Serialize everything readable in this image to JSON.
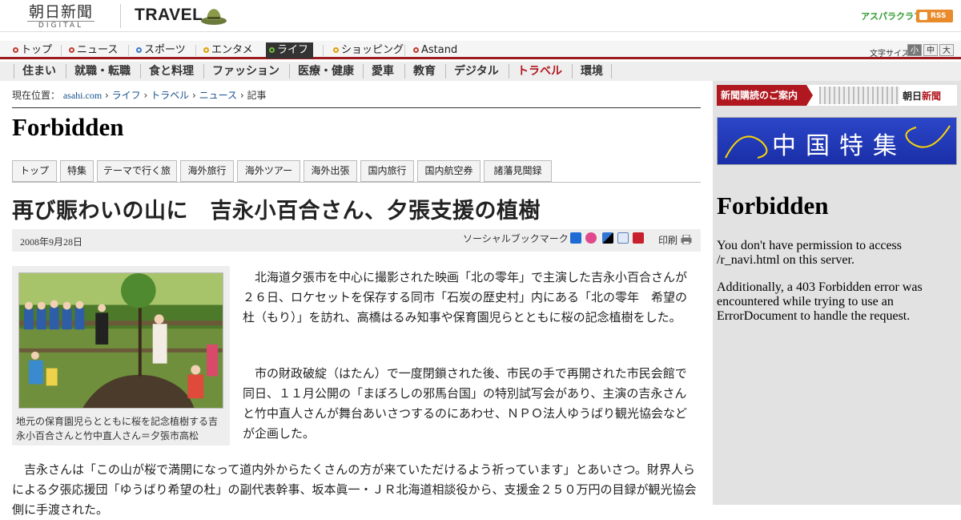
{
  "header": {
    "logo_main": "朝日新聞",
    "logo_sub": "DIGITAL",
    "section_title": "TRAVEL",
    "asupara_link": "アスパラクラブ",
    "rss_label": "RSS"
  },
  "global_nav": {
    "items": [
      {
        "label": "トップ",
        "dot_color": "#c0392b"
      },
      {
        "label": "ニュース",
        "dot_color": "#c0392b"
      },
      {
        "label": "スポーツ",
        "dot_color": "#3a7cc9"
      },
      {
        "label": "エンタメ",
        "dot_color": "#e0a000"
      },
      {
        "label": "ライフ",
        "dot_color": "#6fbf3a",
        "active": true
      },
      {
        "label": "ショッピング",
        "dot_color": "#e0a000"
      },
      {
        "label": "Astand",
        "dot_color": "#c0392b"
      }
    ],
    "font_size_label": "文字サイズ",
    "font_sizes": [
      "小",
      "中",
      "大"
    ]
  },
  "sub_nav": {
    "items": [
      "住まい",
      "就職・転職",
      "食と料理",
      "ファッション",
      "医療・健康",
      "愛車",
      "教育",
      "デジタル",
      "トラベル",
      "環境"
    ],
    "current": "トラベル"
  },
  "breadcrumb": {
    "prefix": "現在位置：",
    "items": [
      "asahi.com",
      "ライフ",
      "トラベル",
      "ニュース",
      "記事"
    ]
  },
  "main_forbidden_title": "Forbidden",
  "section_tabs": [
    "トップ",
    "特集",
    "テーマで行く旅",
    "海外旅行",
    "海外ツアー",
    "海外出張",
    "国内旅行",
    "国内航空券",
    "諸藩見聞録"
  ],
  "article": {
    "headline": "再び賑わいの山に　吉永小百合さん、夕張支援の植樹",
    "date": "2008年9月28日",
    "social_label": "ソーシャルブックマーク",
    "print_label": "印刷",
    "photo_caption": "地元の保育園児らとともに桜を記念植樹する吉永小百合さんと竹中直人さん＝夕張市高松",
    "paragraphs": [
      "　北海道夕張市を中心に撮影された映画「北の零年」で主演した吉永小百合さんが２６日、ロケセットを保存する同市「石炭の歴史村」内にある「北の零年　希望の杜（もり）」を訪れ、高橋はるみ知事や保育園児らとともに桜の記念植樹をした。",
      "　市の財政破綻（はたん）で一度閉鎖された後、市民の手で再開された市民会館で同日、１１月公開の「まぼろしの邪馬台国」の特別試写会があり、主演の吉永さんと竹中直人さんが舞台あいさつするのにあわせ、ＮＰＯ法人ゆうばり観光協会などが企画した。",
      "　吉永さんは「この山が桜で満開になって道内外からたくさんの方が来ていただけるよう祈っています」とあいさつ。財界人らによる夕張応援団「ゆうばり希望の杜」の副代表幹事、坂本眞一・ＪＲ北海道相談役から、支援金２５０万円の目録が観光協会側に手渡された。"
    ]
  },
  "sidebar": {
    "ad1_label": "新聞購読のご案内",
    "ad1_logo_a": "朝日",
    "ad1_logo_b": "新聞",
    "ad2_text": "中国特集",
    "forbidden_title": "Forbidden",
    "forbidden_text_1": "You don't have permission to access /r_navi.html on this server.",
    "forbidden_text_2": "Additionally, a 403 Forbidden error was encountered while trying to use an ErrorDocument to handle the request."
  }
}
